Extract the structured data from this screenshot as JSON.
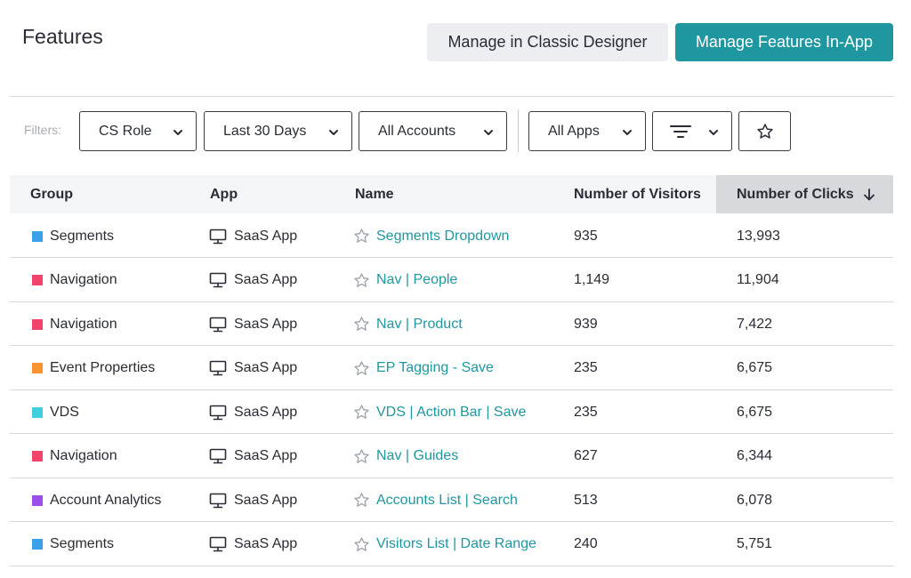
{
  "page": {
    "title": "Features"
  },
  "header": {
    "classic_button": "Manage in Classic Designer",
    "inapp_button": "Manage Features In-App"
  },
  "filters": {
    "label": "Filters:",
    "role": "CS Role",
    "days": "Last 30 Days",
    "accounts": "All Accounts",
    "apps": "All Apps"
  },
  "table": {
    "columns": [
      "Group",
      "App",
      "Name",
      "Number of Visitors",
      "Number of Clicks"
    ],
    "rows": [
      {
        "group": "Segments",
        "color": "#3aa0e8",
        "app": "SaaS App",
        "name": "Segments Dropdown",
        "visitors": "935",
        "clicks": "13,993"
      },
      {
        "group": "Navigation",
        "color": "#f2436a",
        "app": "SaaS App",
        "name": "Nav | People",
        "visitors": "1,149",
        "clicks": "11,904"
      },
      {
        "group": "Navigation",
        "color": "#f2436a",
        "app": "SaaS App",
        "name": "Nav | Product",
        "visitors": "939",
        "clicks": "7,422"
      },
      {
        "group": "Event Properties",
        "color": "#f7922e",
        "app": "SaaS App",
        "name": "EP Tagging - Save",
        "visitors": "235",
        "clicks": "6,675"
      },
      {
        "group": "VDS",
        "color": "#41cfe0",
        "app": "SaaS App",
        "name": "VDS | Action Bar | Save",
        "visitors": "235",
        "clicks": "6,675"
      },
      {
        "group": "Navigation",
        "color": "#f2436a",
        "app": "SaaS App",
        "name": "Nav | Guides",
        "visitors": "627",
        "clicks": "6,344"
      },
      {
        "group": "Account Analytics",
        "color": "#9b4fe8",
        "app": "SaaS App",
        "name": "Accounts List | Search",
        "visitors": "513",
        "clicks": "6,078"
      },
      {
        "group": "Segments",
        "color": "#3aa0e8",
        "app": "SaaS App",
        "name": "Visitors List | Date Range",
        "visitors": "240",
        "clicks": "5,751"
      }
    ]
  }
}
